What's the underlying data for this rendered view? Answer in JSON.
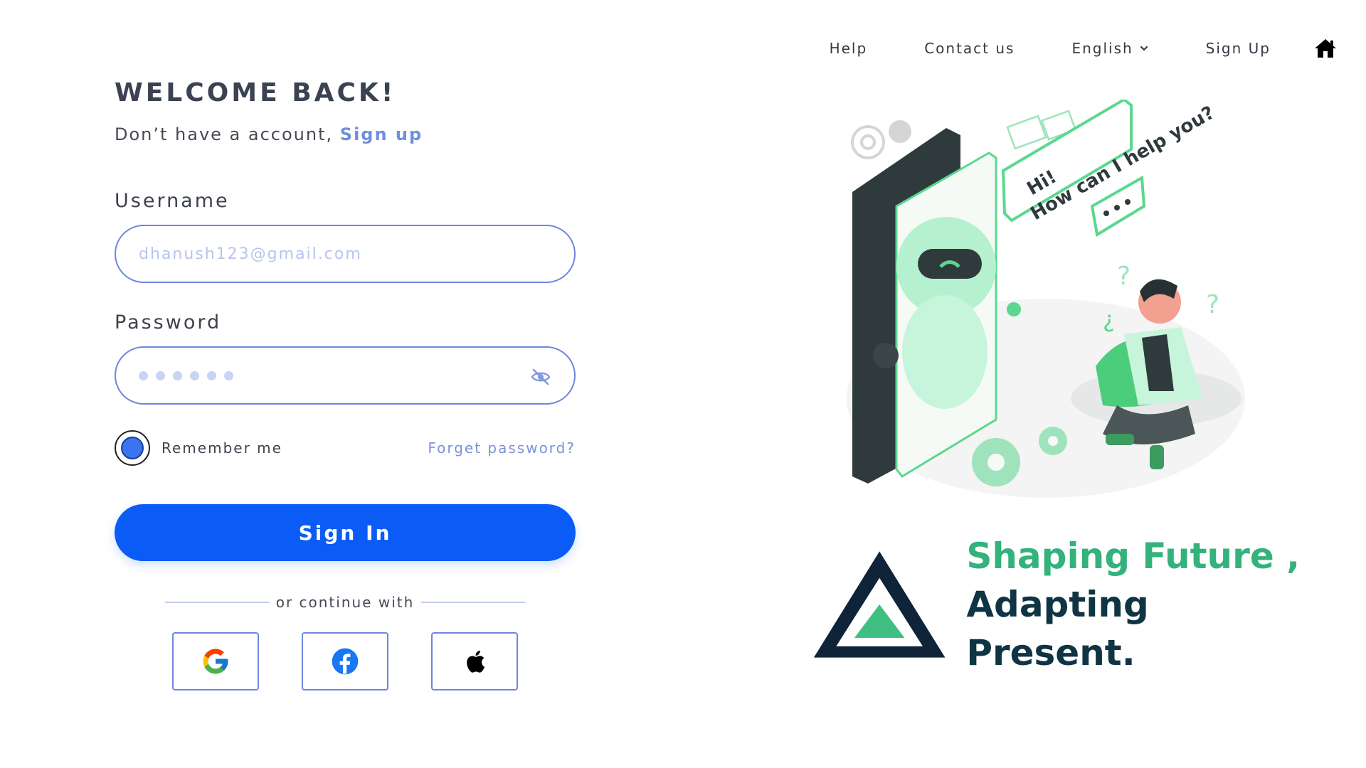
{
  "nav": {
    "items": [
      {
        "label": "Help"
      },
      {
        "label": "Contact us"
      },
      {
        "label": "English"
      },
      {
        "label": "Sign Up"
      }
    ],
    "home_icon": "home-icon"
  },
  "form": {
    "title": "WELCOME BACK!",
    "subtitle_prefix": "Don’t have a account,",
    "subtitle_link": "Sign up",
    "username_label": "Username",
    "username_placeholder": "dhanush123@gmail.com",
    "password_label": "Password",
    "password_masked_length": 6,
    "remember_label": "Remember me",
    "remember_checked": true,
    "forgot_label": "Forget password?",
    "signin_label": "Sign In",
    "divider_text": "or continue with",
    "social": [
      {
        "name": "google-icon"
      },
      {
        "name": "facebook-icon"
      },
      {
        "name": "apple-icon"
      }
    ]
  },
  "illustration": {
    "speech_text_1": "Hi!",
    "speech_text_2": "How can I help you?"
  },
  "brand": {
    "tagline_line1": "Shaping Future ,",
    "tagline_line2": "Adapting Present.",
    "colors": {
      "green": "#34b27b",
      "navy": "#0f3443",
      "accent_blue": "#0b5cf7"
    }
  }
}
